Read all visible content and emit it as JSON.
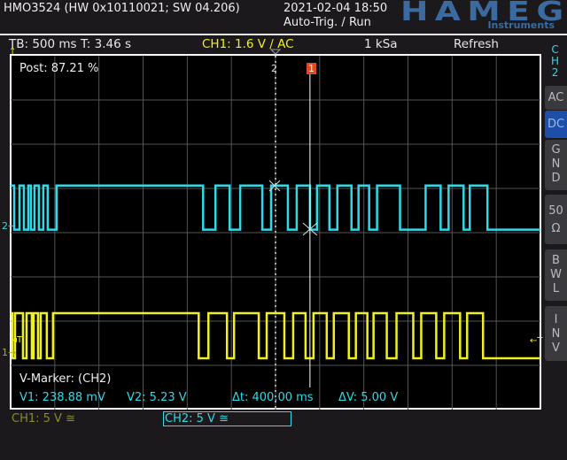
{
  "header": {
    "title": "HMO3524 (HW 0x10110021; SW 04.206)",
    "datetime": "2021-02-04 18:50",
    "trigger_mode": "Auto-Trig. / Run",
    "logo": "HAMEG",
    "logo_sub": "Instruments"
  },
  "status": {
    "timebase": "TB: 500 ms",
    "trig_time": "T: 3.46 s",
    "ch1_trigger": "CH1: 1.6 V ∕ AC",
    "sample_rate": "1 kSa",
    "mode": "Refresh"
  },
  "screen": {
    "post": "Post: 87.21 %",
    "marker2": "2",
    "marker1": "1",
    "t_left": "◂T",
    "t_right": "←T"
  },
  "vmarker": {
    "title": "V-Marker: (CH2)",
    "v1": "V1: 238.88 mV",
    "v2": "V2: 5.23 V",
    "dt": "Δt: 400.00 ms",
    "dv": "ΔV: 5.00 V"
  },
  "channels": {
    "ch1": "CH1: 5 V ≅",
    "ch2": "CH2: 5 V ≅"
  },
  "sidebar": {
    "channel": [
      "C",
      "H",
      "2"
    ],
    "ac": "AC",
    "dc": "DC",
    "gnd": [
      "G",
      "N",
      "D"
    ],
    "ohm": [
      "50",
      "Ω"
    ],
    "bwl": [
      "B",
      "W",
      "L"
    ],
    "inv": [
      "I",
      "N",
      "V"
    ]
  },
  "colors": {
    "ch1": "#f0f020",
    "ch2": "#30d8e8",
    "accent": "#1d4fa8",
    "logo": "#3a6aa0"
  },
  "chart_data": {
    "type": "line",
    "time_per_div_ms": 500,
    "divisions_x": 12,
    "divisions_y": 8,
    "cursor_times_ms": [
      2990,
      3390
    ],
    "series": [
      {
        "name": "CH2",
        "start_level": "high",
        "high_v": 5.23,
        "low_v": 0.24,
        "volts_per_div": 5,
        "edges_ms": [
          40,
          100,
          150,
          200,
          230,
          270,
          320,
          370,
          420,
          520,
          2180,
          2320,
          2480,
          2600,
          2850,
          2950,
          3140,
          3240,
          3390,
          3470,
          3610,
          3700,
          3860,
          3940,
          4060,
          4150,
          4410,
          4700,
          4870,
          4960,
          5130,
          5200,
          5400
        ]
      },
      {
        "name": "CH1",
        "start_level": "high",
        "high_v": 5.1,
        "low_v": 0,
        "volts_per_div": 5,
        "edges_ms": [
          20,
          50,
          140,
          180,
          240,
          260,
          310,
          340,
          410,
          480,
          2130,
          2240,
          2450,
          2530,
          2810,
          2900,
          3100,
          3200,
          3340,
          3430,
          3580,
          3660,
          3830,
          3910,
          4040,
          4110,
          4260,
          4370,
          4560,
          4650,
          4820,
          4910,
          5090,
          5170,
          5350
        ]
      }
    ]
  }
}
